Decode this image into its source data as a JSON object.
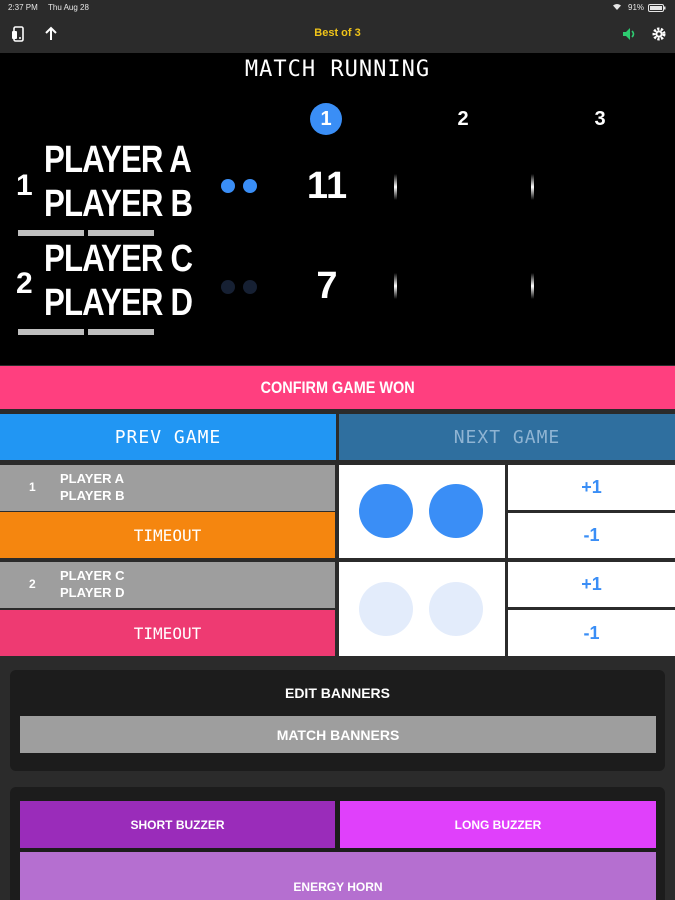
{
  "status": {
    "time": "2:37 PM",
    "date": "Thu Aug 28",
    "battery": "91%"
  },
  "toolbar": {
    "title": "Best of 3"
  },
  "scoreboard": {
    "title": "MATCH RUNNING",
    "games": [
      "1",
      "2",
      "3"
    ],
    "active_game": "1",
    "teams": [
      {
        "number": "1",
        "player1": "PLAYER A",
        "player2": "PLAYER B",
        "score": "11",
        "serves_remaining": 2
      },
      {
        "number": "2",
        "player1": "PLAYER C",
        "player2": "PLAYER D",
        "score": "7",
        "serves_remaining": 0
      }
    ]
  },
  "actions": {
    "confirm": "CONFIRM GAME WON",
    "prev_game": "PREV GAME",
    "next_game": "NEXT GAME"
  },
  "controls": {
    "teams": [
      {
        "number": "1",
        "player1": "PLAYER A",
        "player2": "PLAYER B",
        "timeout": "TIMEOUT",
        "timeout_color": "#f5860f",
        "plus": "+1",
        "minus": "-1"
      },
      {
        "number": "2",
        "player1": "PLAYER C",
        "player2": "PLAYER D",
        "timeout": "TIMEOUT",
        "timeout_color": "#ee3a72",
        "plus": "+1",
        "minus": "-1"
      }
    ]
  },
  "banners": {
    "heading": "EDIT BANNERS",
    "button": "MATCH BANNERS"
  },
  "sounds": {
    "short": "SHORT BUZZER",
    "long": "LONG BUZZER",
    "horn": "ENERGY HORN"
  },
  "colors": {
    "accent": "#3a8ef6",
    "confirm": "#ff3f7f",
    "purple": "#9a2cba",
    "magenta": "#e040fb",
    "violet": "#b56fd0"
  }
}
